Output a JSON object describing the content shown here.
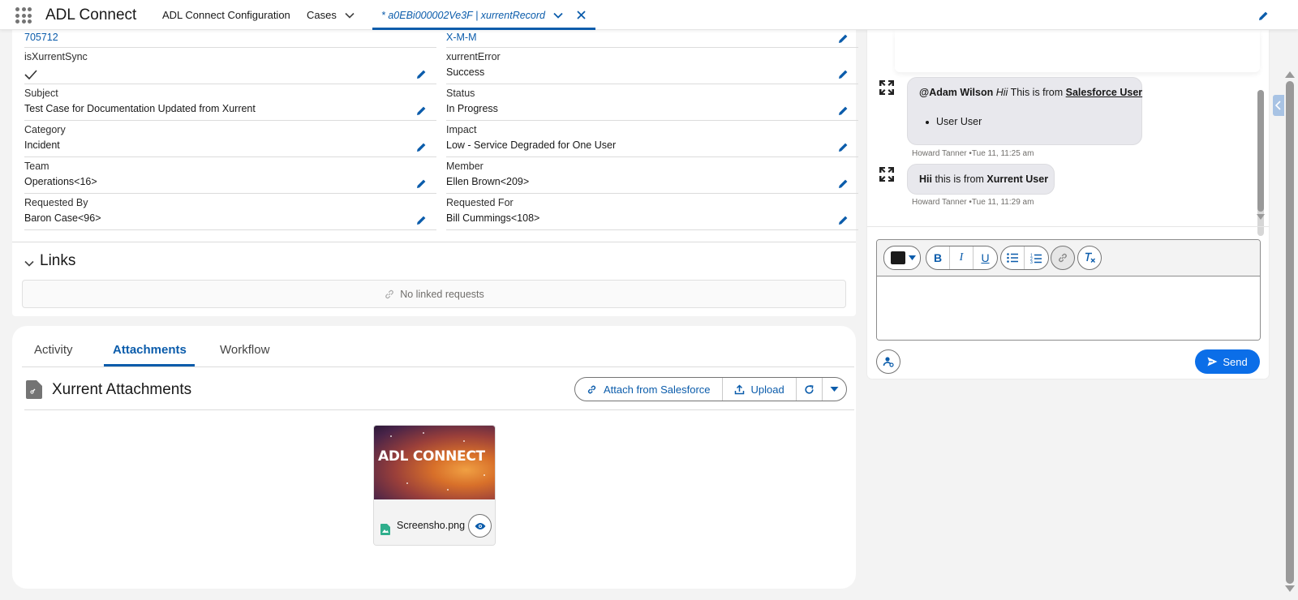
{
  "nav": {
    "app_name": "ADL Connect",
    "items": [
      "ADL Connect Configuration",
      "Cases"
    ],
    "active_tab": "* a0EBi000002Ve3F | xurrentRecord",
    "icons": [
      "app-launcher-icon",
      "chevron-down-icon",
      "close-icon",
      "pencil-icon"
    ]
  },
  "details": {
    "left": [
      {
        "label": "",
        "value": "705712"
      },
      {
        "label": "isXurrentSync",
        "value": ""
      },
      {
        "label": "Subject",
        "value": "Test Case for Documentation Updated from Xurrent"
      },
      {
        "label": "Category",
        "value": "Incident"
      },
      {
        "label": "Team",
        "value": "Operations<16>"
      },
      {
        "label": "Requested By",
        "value": "Baron Case<96>"
      }
    ],
    "right": [
      {
        "label": "",
        "value": "X-M-M"
      },
      {
        "label": "xurrentError",
        "value": "Success"
      },
      {
        "label": "Status",
        "value": "In Progress"
      },
      {
        "label": "Impact",
        "value": "Low - Service Degraded for One User"
      },
      {
        "label": "Member",
        "value": "Ellen Brown<209>"
      },
      {
        "label": "Requested For",
        "value": "Bill Cummings<108>"
      }
    ]
  },
  "links": {
    "title": "Links",
    "empty_text": "No linked requests"
  },
  "attachments": {
    "tabs": [
      "Activity",
      "Attachments",
      "Workflow"
    ],
    "active_tab": "Attachments",
    "title": "Xurrent Attachments",
    "buttons": {
      "attach": "Attach from Salesforce",
      "upload": "Upload"
    },
    "files": [
      {
        "thumbnail_text": "ADL CONNECT",
        "name": "Screensho.png"
      }
    ]
  },
  "chat": {
    "messages": [
      {
        "mention": "@Adam Wilson",
        "italic": "Hii",
        "text": " This is from ",
        "bold_underline": "Salesforce User",
        "bullet": "User User",
        "meta": "Howard Tanner •Tue 11, 11:25 am"
      },
      {
        "bold_start": "Hii",
        "text": " this is from ",
        "bold_end": "Xurrent User",
        "meta": "Howard Tanner •Tue 11, 11:29 am"
      }
    ],
    "toolbar": {
      "swatch_color": "#1a1a1a",
      "bold": "B",
      "italic": "I",
      "underline": "U"
    },
    "send_label": "Send"
  },
  "colors": {
    "brand": "#0b5cab",
    "send": "#0b6ee8"
  }
}
